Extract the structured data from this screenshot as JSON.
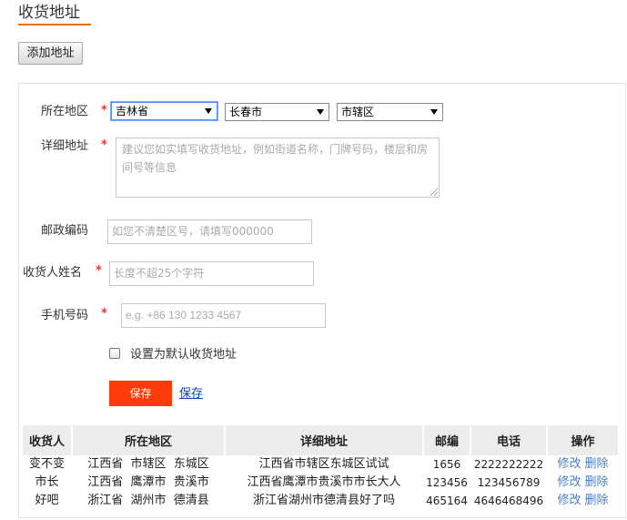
{
  "page": {
    "title": "收货地址",
    "add_button": "添加地址"
  },
  "form": {
    "region_label": "所在地区",
    "province": "吉林省",
    "city": "长春市",
    "district": "市辖区",
    "detail_label": "详细地址",
    "detail_placeholder": "建议您如实填写收货地址，例如街道名称，门牌号码，楼层和房间号等信息",
    "postcode_label": "邮政编码",
    "postcode_placeholder": "如您不清楚区号，请填写000000",
    "name_label": "收货人姓名",
    "name_placeholder": "长度不超25个字符",
    "phone_label": "手机号码",
    "phone_placeholder": "e.g. +86 130 1233 4567",
    "required_mark": "*",
    "default_label": "设置为默认收货地址",
    "default_checked": false,
    "save_button": "保存",
    "save_link": "保存"
  },
  "table": {
    "headers": [
      "收货人",
      "所在地区",
      "详细地址",
      "邮编",
      "电话",
      "操作"
    ],
    "rows": [
      {
        "name": "变不变",
        "region": "江西省  市辖区  东城区",
        "detail": "江西省市辖区东城区试试",
        "postcode": "1656",
        "phone": "2222222222",
        "edit": "修改",
        "delete": "删除"
      },
      {
        "name": "市长",
        "region": "江西省  鹰潭市  贵溪市",
        "detail": "江西省鹰潭市贵溪市市长大人",
        "postcode": "123456",
        "phone": "123456789",
        "edit": "修改",
        "delete": "删除"
      },
      {
        "name": "好吧",
        "region": "浙江省  湖州市  德清县",
        "detail": "浙江省湖州市德清县好了吗",
        "postcode": "465164",
        "phone": "4646468496",
        "edit": "修改",
        "delete": "删除"
      }
    ]
  },
  "colors": {
    "accent_orange": "#e8700b",
    "save_red": "#ff3b0a",
    "required_red": "#e4393c",
    "link_blue": "#4a7fc1"
  }
}
